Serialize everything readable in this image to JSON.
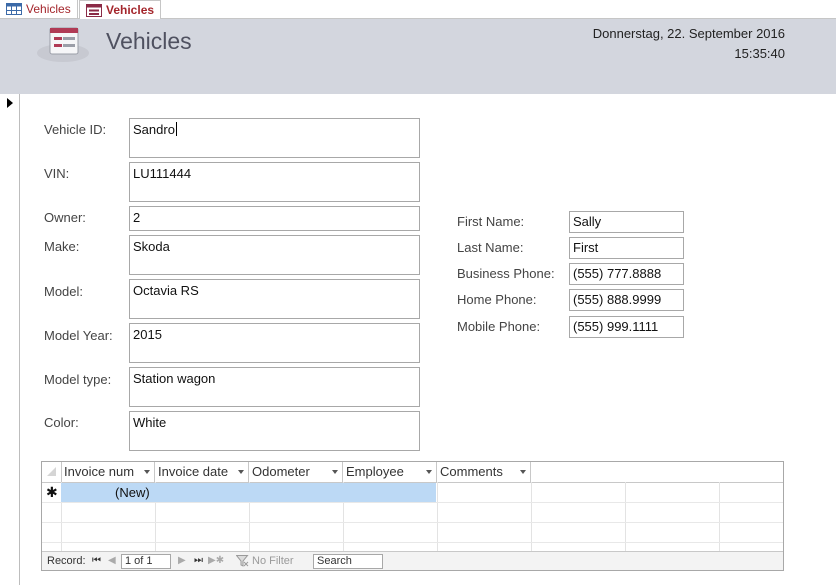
{
  "tabs": [
    {
      "label": "Vehicles",
      "icon": "table-icon",
      "active": false
    },
    {
      "label": "Vehicles",
      "icon": "form-icon",
      "active": true
    }
  ],
  "header": {
    "title": "Vehicles",
    "date": "Donnerstag, 22. September 2016",
    "time": "15:35:40"
  },
  "vehicle": {
    "vehicle_id_label": "Vehicle ID:",
    "vehicle_id": "Sandro",
    "vin_label": "VIN:",
    "vin": "LU111444",
    "owner_label": "Owner:",
    "owner": "2",
    "make_label": "Make:",
    "make": "Skoda",
    "model_label": "Model:",
    "model": "Octavia RS",
    "model_year_label": "Model Year:",
    "model_year": "2015",
    "model_type_label": "Model type:",
    "model_type": "Station wagon",
    "color_label": "Color:",
    "color": "White"
  },
  "owner": {
    "first_name_label": "First Name:",
    "first_name": "Sally",
    "last_name_label": "Last Name:",
    "last_name": "First",
    "business_phone_label": "Business Phone:",
    "business_phone": "(555) 777.8888",
    "home_phone_label": "Home Phone:",
    "home_phone": "(555) 888.9999",
    "mobile_phone_label": "Mobile Phone:",
    "mobile_phone": "(555) 999.1111"
  },
  "subform": {
    "columns": [
      "Invoice num",
      "Invoice date",
      "Odometer",
      "Employee",
      "Comments"
    ],
    "new_row_marker": "✱",
    "new_row_text": "(New)"
  },
  "navigation": {
    "record_label": "Record:",
    "first_glyph": "⏮",
    "prev_glyph": "◀",
    "position": "1 of 1",
    "next_glyph": "▶",
    "last_glyph": "⏭",
    "new_glyph": "▶✱",
    "filter_label": "No Filter",
    "search_label": "Search"
  },
  "colors": {
    "tab_text": "#a4262c",
    "header_bg": "#d3d6de",
    "new_row_highlight": "#bcd9f5"
  }
}
